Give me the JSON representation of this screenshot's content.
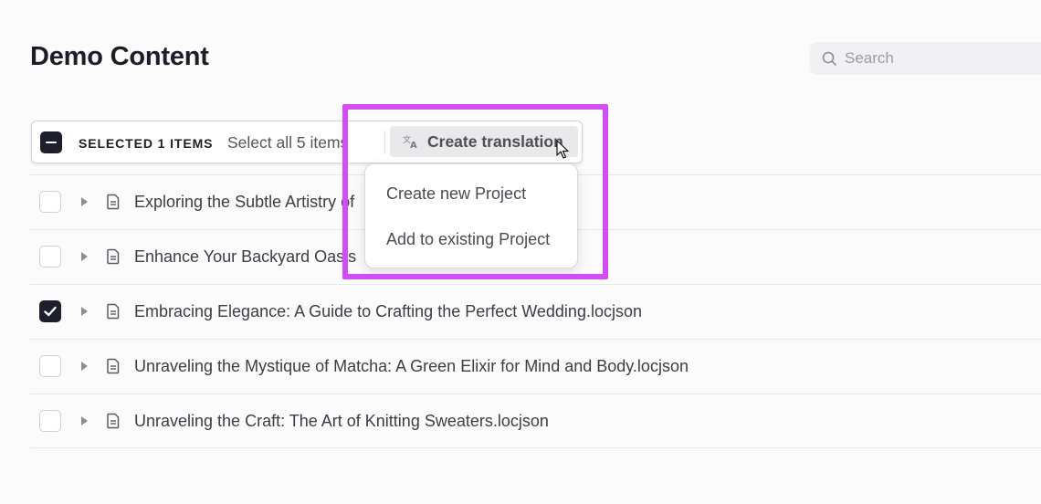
{
  "page": {
    "title": "Demo Content"
  },
  "search": {
    "placeholder": "Search",
    "icon": "search-icon"
  },
  "selection_bar": {
    "count_label": "SELECTED 1 ITEMS",
    "select_all_label": "Select all 5 items",
    "action_label": "Create translation",
    "action_icon": "translate-icon"
  },
  "dropdown": {
    "items": [
      {
        "label": "Create new Project"
      },
      {
        "label": "Add to existing Project"
      }
    ]
  },
  "files": [
    {
      "name": "Exploring the Subtle Artistry of",
      "checked": false
    },
    {
      "name": "Enhance Your Backyard Oasis",
      "checked": false
    },
    {
      "name": "Embracing Elegance: A Guide to Crafting the Perfect Wedding.locjson",
      "checked": true
    },
    {
      "name": "Unraveling the Mystique of Matcha: A Green Elixir for Mind and Body.locjson",
      "checked": false
    },
    {
      "name": "Unraveling the Craft: The Art of Knitting Sweaters.locjson",
      "checked": false
    }
  ],
  "colors": {
    "accent_dark": "#1e1e2c",
    "highlight": "#d44cf3",
    "button_bg": "#e9e9ec"
  }
}
